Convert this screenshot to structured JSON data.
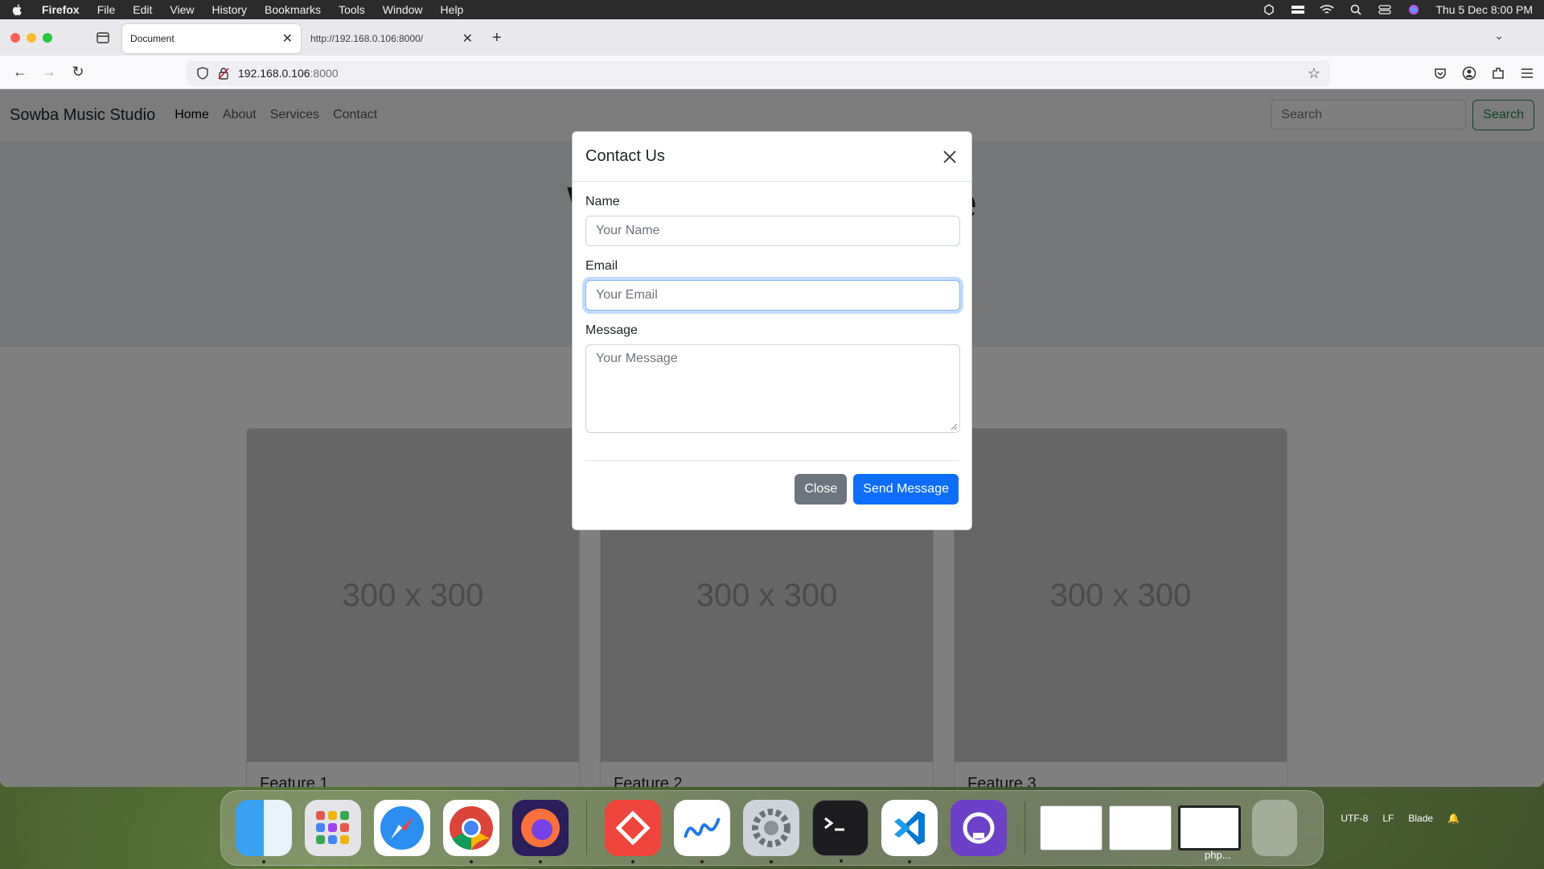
{
  "menubar": {
    "app_name": "Firefox",
    "menus": [
      "File",
      "Edit",
      "View",
      "History",
      "Bookmarks",
      "Tools",
      "Window",
      "Help"
    ],
    "clock": "Thu 5 Dec  8:00 PM"
  },
  "browser": {
    "tabs": [
      {
        "title": "Document"
      },
      {
        "title": "http://192.168.0.106:8000/"
      }
    ],
    "url_host": "192.168.0.106",
    "url_port": ":8000"
  },
  "site": {
    "brand": "Sowba Music Studio",
    "nav": [
      "Home",
      "About",
      "Services",
      "Contact"
    ],
    "search_placeholder": "Search",
    "search_button": "Search",
    "hero_left": "W",
    "hero_right": "e",
    "features": [
      {
        "placeholder": "300 x 300",
        "title": "Feature 1"
      },
      {
        "placeholder": "300 x 300",
        "title": "Feature 2"
      },
      {
        "placeholder": "300 x 300",
        "title": "Feature 3"
      }
    ]
  },
  "modal": {
    "title": "Contact Us",
    "name_label": "Name",
    "name_placeholder": "Your Name",
    "email_label": "Email",
    "email_placeholder": "Your Email",
    "message_label": "Message",
    "message_placeholder": "Your Message",
    "close_button": "Close",
    "send_button": "Send Message"
  },
  "dock": {
    "apps": [
      "finder-icon",
      "launchpad-icon",
      "safari-icon",
      "chrome-icon",
      "firefox-icon",
      "anydesk-icon",
      "freeform-icon",
      "system-settings-icon",
      "terminal-icon",
      "vscode-icon",
      "github-desktop-icon"
    ],
    "thumb_label": "php...",
    "status": [
      "UTF-8",
      "LF",
      "Blade"
    ]
  }
}
